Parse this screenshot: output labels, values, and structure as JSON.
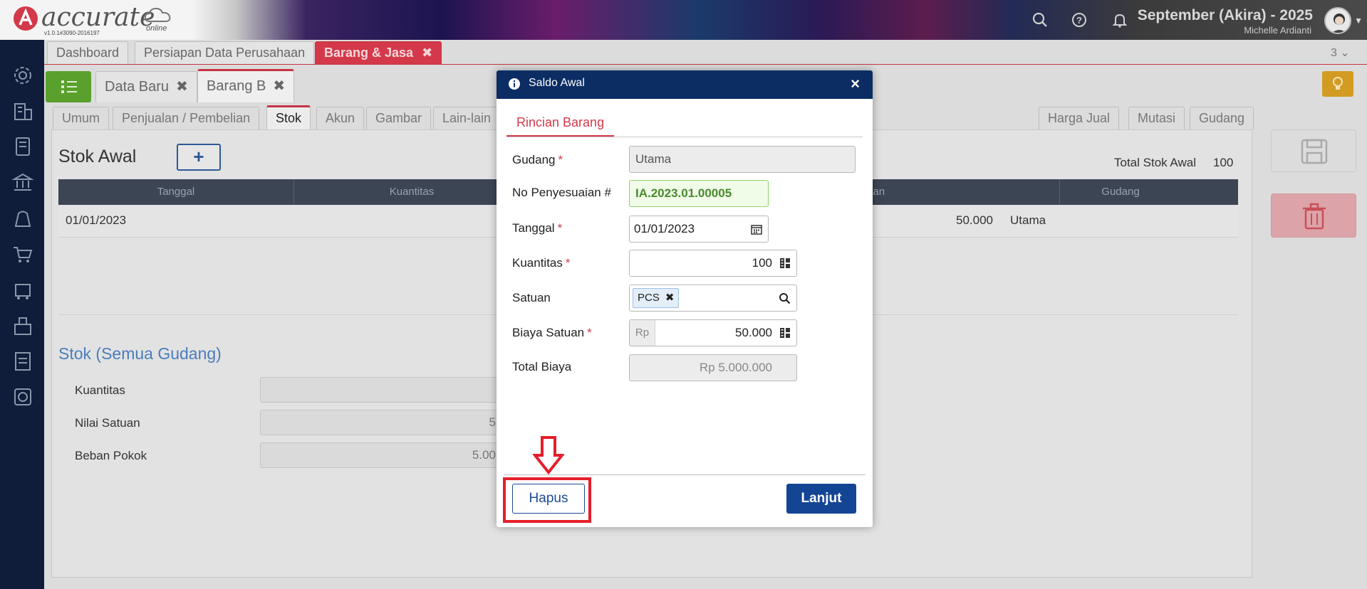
{
  "header": {
    "brand": "accurate",
    "brand_sub": "online",
    "version": "v1.0.1#3090-2016197",
    "period": "September (Akira) - 2025",
    "user": "Michelle Ardianti"
  },
  "tabs_top": [
    {
      "label": "Dashboard"
    },
    {
      "label": "Persiapan Data Perusahaan"
    },
    {
      "label": "Barang & Jasa"
    }
  ],
  "tab_count": "3",
  "tabs_doc": [
    {
      "label": "Data Baru"
    },
    {
      "label": "Barang B"
    }
  ],
  "tabs_section": [
    "Umum",
    "Penjualan / Pembelian",
    "Stok",
    "Akun",
    "Gambar",
    "Lain-lain"
  ],
  "tabs_right": [
    "Harga Jual",
    "Mutasi",
    "Gudang"
  ],
  "stok_awal": {
    "title": "Stok Awal",
    "add_label": "+",
    "total_label": "Total Stok Awal",
    "total_value": "100",
    "columns": [
      "Tanggal",
      "Kuantitas",
      "a Satuan",
      "Gudang"
    ],
    "rows": [
      {
        "tanggal": "01/01/2023",
        "nilai": "50.000",
        "gudang": "Utama"
      }
    ]
  },
  "stok_semua": {
    "title": "Stok (Semua Gudang)",
    "labels": [
      "Kuantitas",
      "Nilai Satuan",
      "Beban Pokok"
    ],
    "values": [
      "",
      "5",
      "5.00"
    ]
  },
  "modal": {
    "title": "Saldo Awal",
    "close": "×",
    "tab": "Rincian Barang",
    "fields": {
      "gudang_label": "Gudang",
      "gudang_value": "Utama",
      "no_label": "No Penyesuaian #",
      "no_value": "IA.2023.01.00005",
      "tanggal_label": "Tanggal",
      "tanggal_value": "01/01/2023",
      "kuantitas_label": "Kuantitas",
      "kuantitas_value": "100",
      "satuan_label": "Satuan",
      "satuan_value": "PCS",
      "biaya_label": "Biaya Satuan",
      "biaya_prefix": "Rp",
      "biaya_value": "50.000",
      "total_label": "Total Biaya",
      "total_value": "Rp 5.000.000"
    },
    "required_mark": "*",
    "hapus_label": "Hapus",
    "lanjut_label": "Lanjut"
  },
  "colors": {
    "accent_red": "#d3394a",
    "modal_header": "#0b2d63",
    "primary_button": "#144594",
    "highlight": "#e41f2b"
  }
}
